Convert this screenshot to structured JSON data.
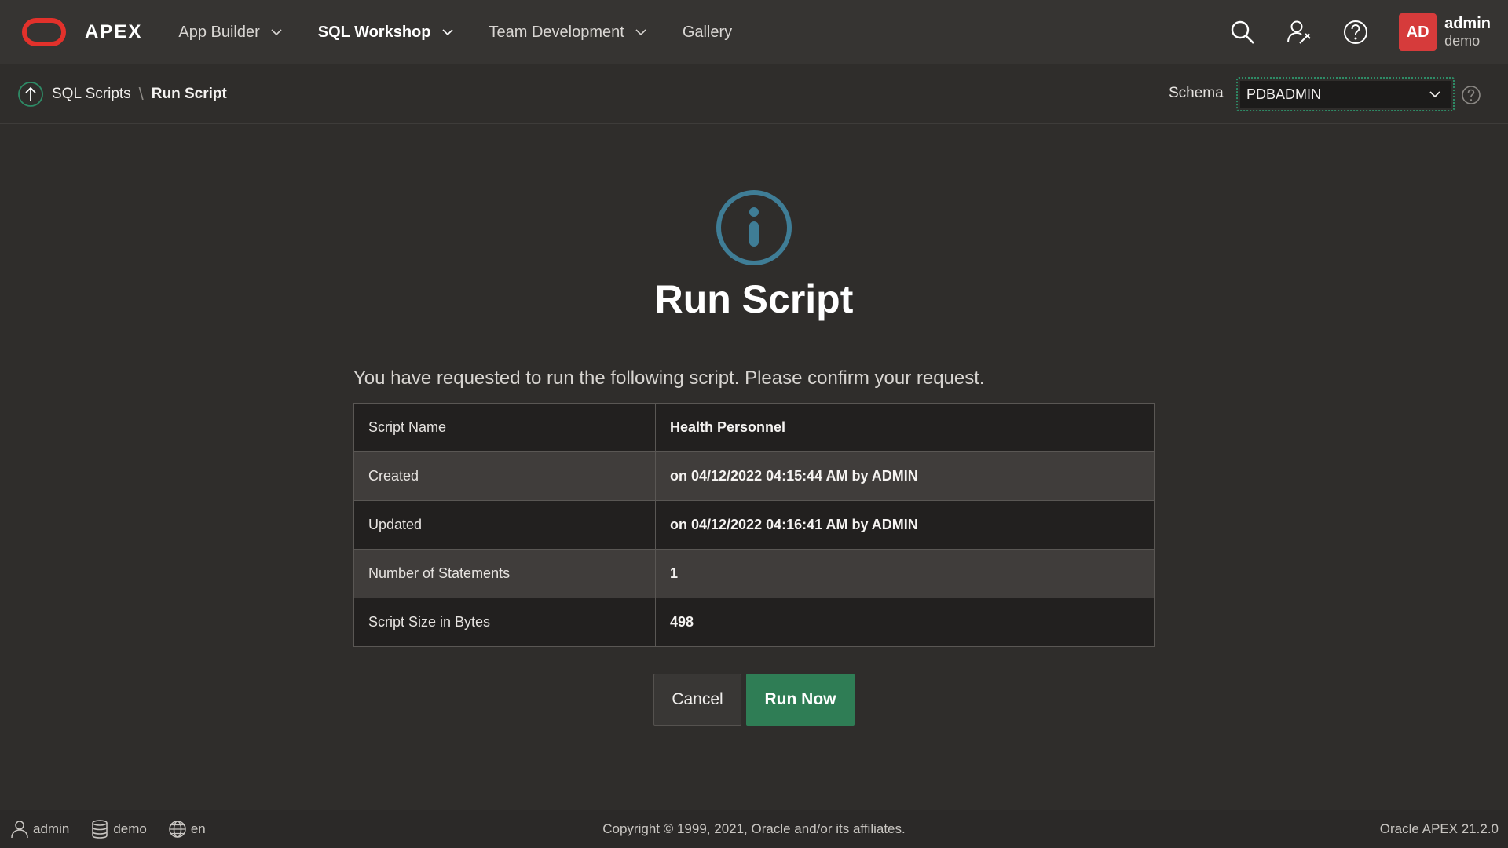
{
  "header": {
    "logo_text": "APEX",
    "nav": [
      {
        "label": "App Builder"
      },
      {
        "label": "SQL Workshop"
      },
      {
        "label": "Team Development"
      },
      {
        "label": "Gallery"
      }
    ],
    "avatar_initials": "AD",
    "user_name": "admin",
    "workspace": "demo"
  },
  "breadcrumb": {
    "parent": "SQL Scripts",
    "separator": "\\",
    "current": "Run Script"
  },
  "schema": {
    "label": "Schema",
    "value": "PDBADMIN"
  },
  "main": {
    "title": "Run Script",
    "intro": "You have requested to run the following script. Please confirm your request.",
    "rows": [
      {
        "key": "Script Name",
        "value": "Health Personnel"
      },
      {
        "key": "Created",
        "value": "on 04/12/2022 04:15:44 AM by ADMIN"
      },
      {
        "key": "Updated",
        "value": "on 04/12/2022 04:16:41 AM by ADMIN"
      },
      {
        "key": "Number of Statements",
        "value": "1"
      },
      {
        "key": "Script Size in Bytes",
        "value": "498"
      }
    ],
    "cancel_label": "Cancel",
    "run_label": "Run Now"
  },
  "footer": {
    "user": "admin",
    "workspace": "demo",
    "language": "en",
    "copyright": "Copyright © 1999, 2021, Oracle and/or its affiliates.",
    "version": "Oracle APEX 21.2.0"
  },
  "colors": {
    "brand_red": "#e2312b",
    "accent_green": "#2f7d55",
    "info_icon": "#3f7d96",
    "background": "#2f2d2b"
  }
}
